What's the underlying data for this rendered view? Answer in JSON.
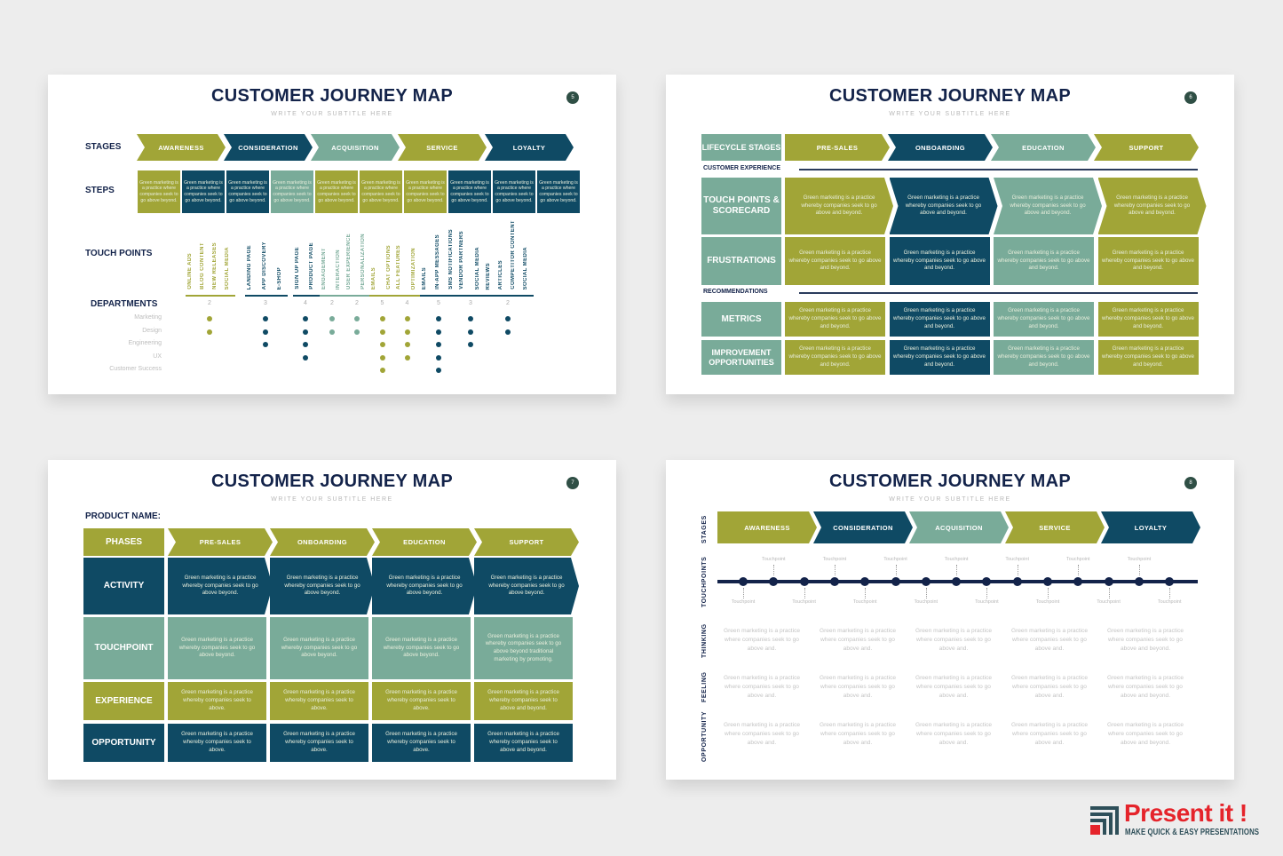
{
  "colors": {
    "olive": "#a1a537",
    "navy": "#0f4a64",
    "sage": "#79ab99",
    "title": "#13234a",
    "brand_red": "#e5242b"
  },
  "slides": [
    {
      "title": "CUSTOMER JOURNEY MAP",
      "subtitle": "WRITE YOUR SUBTITLE HERE",
      "page": "5",
      "row_labels": {
        "stages": "STAGES",
        "steps": "STEPS",
        "touch_points": "TOUCH POINTS",
        "departments": "DEPARTMENTS"
      },
      "stages": [
        {
          "label": "AWARENESS",
          "color": "olive"
        },
        {
          "label": "CONSIDERATION",
          "color": "navy"
        },
        {
          "label": "ACQUISITION",
          "color": "sage"
        },
        {
          "label": "SERVICE",
          "color": "olive"
        },
        {
          "label": "LOYALTY",
          "color": "navy"
        }
      ],
      "steps": [
        {
          "text": "Green marketing is a practice where companies seek to go above beyond.",
          "color": "olive"
        },
        {
          "text": "Green marketing is a practice where companies seek to go above beyond.",
          "color": "navy"
        },
        {
          "text": "Green marketing is a practice where companies seek to go above beyond.",
          "color": "navy"
        },
        {
          "text": "Green marketing is a practice where companies seek to go above beyond.",
          "color": "sage"
        },
        {
          "text": "Green marketing is a practice where companies seek to go above beyond.",
          "color": "olive"
        },
        {
          "text": "Green marketing is a practice where companies seek to go above beyond.",
          "color": "olive"
        },
        {
          "text": "Green marketing is a practice where companies seek to go above beyond.",
          "color": "olive"
        },
        {
          "text": "Green marketing is a practice where companies seek to go above beyond.",
          "color": "navy"
        },
        {
          "text": "Green marketing is a practice where companies seek to go above beyond.",
          "color": "navy"
        },
        {
          "text": "Green marketing is a practice where companies seek to go above beyond.",
          "color": "navy"
        }
      ],
      "departments": [
        "Marketing",
        "Design",
        "Engineering",
        "UX",
        "Customer Success"
      ],
      "touch_groups": [
        {
          "color": "olive",
          "items": [
            "ONLINE ADS",
            "BLOG CONTENT",
            "NEW RELEASES",
            "SOCIAL MEDIA"
          ],
          "count": "2",
          "depts": [
            0,
            1
          ]
        },
        {
          "color": "navy",
          "items": [
            "LANDING PAGE",
            "APP DISCOVERY",
            "E-SHOP"
          ],
          "count": "3",
          "depts": [
            0,
            1,
            2
          ]
        },
        {
          "color": "navy",
          "items": [
            "SIGN UP PAGE",
            "PRODUCT PAGE"
          ],
          "count": "4",
          "depts": [
            0,
            1,
            2,
            3
          ]
        },
        {
          "color": "sage",
          "items": [
            "ENGAGEMENT",
            "INTERACTION"
          ],
          "count": "2",
          "depts": [
            0,
            1
          ]
        },
        {
          "color": "sage",
          "items": [
            "USER EXPERIENCE",
            "PERSONALIZATION"
          ],
          "count": "2",
          "depts": [
            0,
            1
          ]
        },
        {
          "color": "olive",
          "items": [
            "EMAILS",
            "CHAT OPTIONS"
          ],
          "count": "5",
          "depts": [
            0,
            1,
            2,
            3,
            4
          ]
        },
        {
          "color": "olive",
          "items": [
            "ALL FEATURES",
            "OPTIMIZATION"
          ],
          "count": "4",
          "depts": [
            0,
            1,
            2,
            3
          ]
        },
        {
          "color": "navy",
          "items": [
            "EMAILS",
            "IN-APP MESSAGES",
            "SMS NOTIFICATIONS"
          ],
          "count": "5",
          "depts": [
            0,
            1,
            2,
            3,
            4
          ]
        },
        {
          "color": "navy",
          "items": [
            "VENDOR PARTNERS",
            "SOCIAL MEDIA"
          ],
          "count": "3",
          "depts": [
            0,
            1,
            2
          ]
        },
        {
          "color": "navy",
          "items": [
            "REVIEWS",
            "ARTICLES",
            "COMPETITOR CONTENT",
            "SOCIAL MEDIA"
          ],
          "count": "2",
          "depts": [
            0,
            1
          ]
        }
      ]
    },
    {
      "title": "CUSTOMER JOURNEY MAP",
      "subtitle": "WRITE YOUR SUBTITLE HERE",
      "page": "6",
      "lifecycle_label": "LIFECYCLE STAGES",
      "stages": [
        {
          "label": "PRE-SALES",
          "color": "olive"
        },
        {
          "label": "ONBOARDING",
          "color": "navy"
        },
        {
          "label": "EDUCATION",
          "color": "sage"
        },
        {
          "label": "SUPPORT",
          "color": "olive"
        }
      ],
      "section_customer_experience": "CUSTOMER EXPERIENCE",
      "section_recommendations": "RECOMMENDATIONS",
      "rows": [
        {
          "label": "TOUCH POINTS & SCORECARD",
          "cells": [
            "Green marketing is a practice whereby companies seek to go above and beyond.",
            "Green marketing is a practice whereby companies seek to go above and beyond.",
            "Green marketing is a practice whereby companies seek to go above and beyond.",
            "Green marketing is a practice whereby companies seek to go above and beyond."
          ]
        },
        {
          "label": "FRUSTRATIONS",
          "cells": [
            "Green marketing is a practice whereby companies seek to go above and beyond.",
            "Green marketing is a practice whereby companies seek to go above and beyond.",
            "Green marketing is a practice whereby companies seek to go above and beyond.",
            "Green marketing is a practice whereby companies seek to go above and beyond."
          ]
        },
        {
          "label": "METRICS",
          "cells": [
            "Green marketing is a practice whereby companies seek to go above and beyond.",
            "Green marketing is a practice whereby companies seek to go above and beyond.",
            "Green marketing is a practice whereby companies seek to go above and beyond.",
            "Green marketing is a practice whereby companies seek to go above and beyond."
          ]
        },
        {
          "label": "IMPROVEMENT OPPORTUNITIES",
          "cells": [
            "Green marketing is a practice whereby companies seek to go above and beyond.",
            "Green marketing is a practice whereby companies seek to go above and beyond.",
            "Green marketing is a practice whereby companies seek to go above and beyond.",
            "Green marketing is a practice whereby companies seek to go above and beyond."
          ]
        }
      ]
    },
    {
      "title": "CUSTOMER JOURNEY MAP",
      "subtitle": "WRITE YOUR SUBTITLE HERE",
      "page": "7",
      "product_name_label": "PRODUCT NAME:",
      "phases_label": "PHASES",
      "phases": [
        "PRE-SALES",
        "ONBOARDING",
        "EDUCATION",
        "SUPPORT"
      ],
      "rows": [
        {
          "label": "ACTIVITY",
          "color": "navy",
          "cells": [
            "Green marketing is a practice whereby companies seek to go above beyond.",
            "Green marketing is a practice whereby companies seek to go above beyond.",
            "Green marketing is a practice whereby companies seek to go above beyond.",
            "Green marketing is a practice whereby companies seek to go above beyond."
          ]
        },
        {
          "label": "TOUCHPOINT",
          "color": "sage",
          "cells": [
            "Green marketing is a practice whereby companies seek to go above beyond.",
            "Green marketing is a practice whereby companies seek to go above beyond.",
            "Green marketing is a practice whereby companies seek to go above beyond.",
            "Green marketing is a practice whereby companies seek to go above beyond traditional marketing by promoting."
          ]
        },
        {
          "label": "EXPERIENCE",
          "color": "olive",
          "cells": [
            "Green marketing is a practice whereby companies seek to above.",
            "Green marketing is a practice whereby companies seek to above.",
            "Green marketing is a practice whereby companies seek to above.",
            "Green marketing is a practice whereby companies seek to above and beyond."
          ]
        },
        {
          "label": "OPPORTUNITY",
          "color": "navy",
          "cells": [
            "Green marketing is a practice whereby companies seek to above.",
            "Green marketing is a practice whereby companies seek to above.",
            "Green marketing is a practice whereby companies seek to above.",
            "Green marketing is a practice whereby companies seek to above and beyond."
          ]
        }
      ]
    },
    {
      "title": "CUSTOMER JOURNEY MAP",
      "subtitle": "WRITE YOUR SUBTITLE HERE",
      "page": "8",
      "side_labels": {
        "stages": "STAGES",
        "touchpoints": "TOUCHPOINTS",
        "thinking": "THINKING",
        "feeling": "FEELING",
        "opportunity": "OPPORTUNITY"
      },
      "stages": [
        {
          "label": "AWARENESS",
          "color": "olive"
        },
        {
          "label": "CONSIDERATION",
          "color": "navy"
        },
        {
          "label": "ACQUISITION",
          "color": "sage"
        },
        {
          "label": "SERVICE",
          "color": "olive"
        },
        {
          "label": "LOYALTY",
          "color": "navy"
        }
      ],
      "touchpoint_label": "Touchpoint",
      "touchpoint_count": 15,
      "thinking": [
        "Green marketing is a practice where companies seek to go above and.",
        "Green marketing is a practice where companies seek to go above and.",
        "Green marketing is a practice where companies seek to go above and.",
        "Green marketing is a practice where companies seek to go above and.",
        "Green marketing is a practice where companies seek to go above and beyond."
      ],
      "feeling": [
        "Green marketing is a practice where companies seek to go above and.",
        "Green marketing is a practice where companies seek to go above and.",
        "Green marketing is a practice where companies seek to go above and.",
        "Green marketing is a practice where companies seek to go above and.",
        "Green marketing is a practice where companies seek to go above and beyond."
      ],
      "opportunity": [
        "Green marketing is a practice where companies seek to go above and.",
        "Green marketing is a practice where companies seek to go above and.",
        "Green marketing is a practice where companies seek to go above and.",
        "Green marketing is a practice where companies seek to go above and.",
        "Green marketing is a practice where companies seek to go above and beyond."
      ]
    }
  ],
  "brand": {
    "name": "Present it !",
    "tagline": "MAKE QUICK & EASY PRESENTATIONS"
  }
}
